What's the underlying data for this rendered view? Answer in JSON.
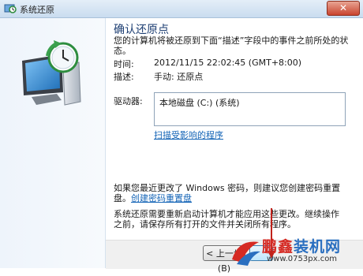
{
  "window": {
    "title": "系统还原",
    "close_label": "✕"
  },
  "main": {
    "heading": "确认还原点",
    "description": "您的计算机将被还原到下面“描述”字段中的事件之前所处的状态。",
    "time_label": "时间:",
    "time_value": "2012/11/15 22:02:45 (GMT+8:00)",
    "desc_label": "描述:",
    "desc_value": "手动: 还原点",
    "drives_label": "驱动器:",
    "drives_value": "本地磁盘 (C:) (系统)",
    "scan_link": "扫描受影响的程序",
    "password_text_before": "如果您最近更改了 Windows 密码，则建议您创建密码重置盘。",
    "password_link": "创建密码重置盘",
    "warning_text": "系统还原需要重新启动计算机才能应用这些更改。继续操作之前，请保存所有打开的文件并关闭所有程序。"
  },
  "buttons": {
    "back_label": "< 上一步(B)",
    "finish_label": ""
  },
  "watermark": {
    "brand_red": "鹏鑫",
    "brand_blue": "装机网",
    "url": "www.0753px.com"
  },
  "colors": {
    "heading": "#1e3f73",
    "link": "#1565b7",
    "watermark_blue": "#2a6fc0",
    "watermark_red": "#d52a23"
  }
}
